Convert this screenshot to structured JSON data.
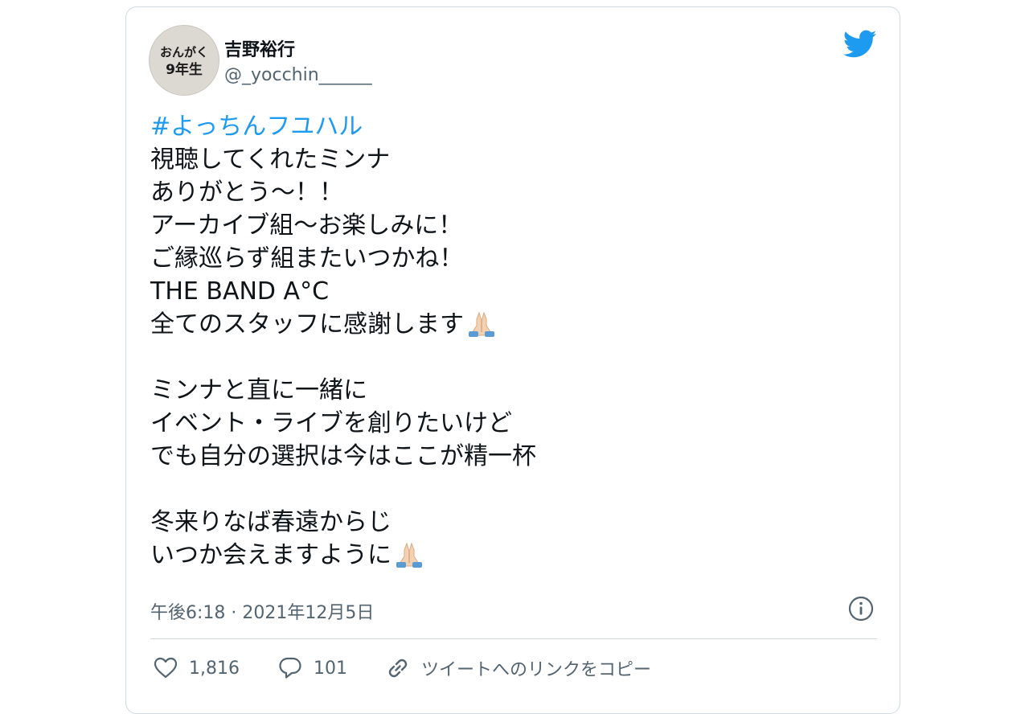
{
  "user": {
    "display_name": "吉野裕行",
    "handle": "@_yocchin______",
    "avatar_text": [
      "おんがく",
      "9年生"
    ]
  },
  "tweet": {
    "hashtag": "#よっちんフユハル",
    "lines": [
      "視聴してくれたミンナ",
      "ありがとう〜！！",
      "アーカイブ組〜お楽しみに！",
      "ご縁巡らず組またいつかね！",
      "THE BAND A°C",
      "全てのスタッフに感謝します",
      "",
      "ミンナと直に一緒に",
      "イベント・ライブを創りたいけど",
      "でも自分の選択は今はここが精一杯",
      "",
      "冬来りなば春遠からじ",
      "いつか会えますように"
    ],
    "emojis": [
      "folded-hands",
      "folded-hands"
    ],
    "timestamp": "午後6:18 · 2021年12月5日"
  },
  "actions": {
    "like_count": "1,816",
    "reply_count": "101",
    "copy_link_label": "ツイートへのリンクをコピー"
  },
  "colors": {
    "accent": "#1d9bf0",
    "text": "#0f1419",
    "muted": "#536471",
    "border": "#cfd9de"
  }
}
